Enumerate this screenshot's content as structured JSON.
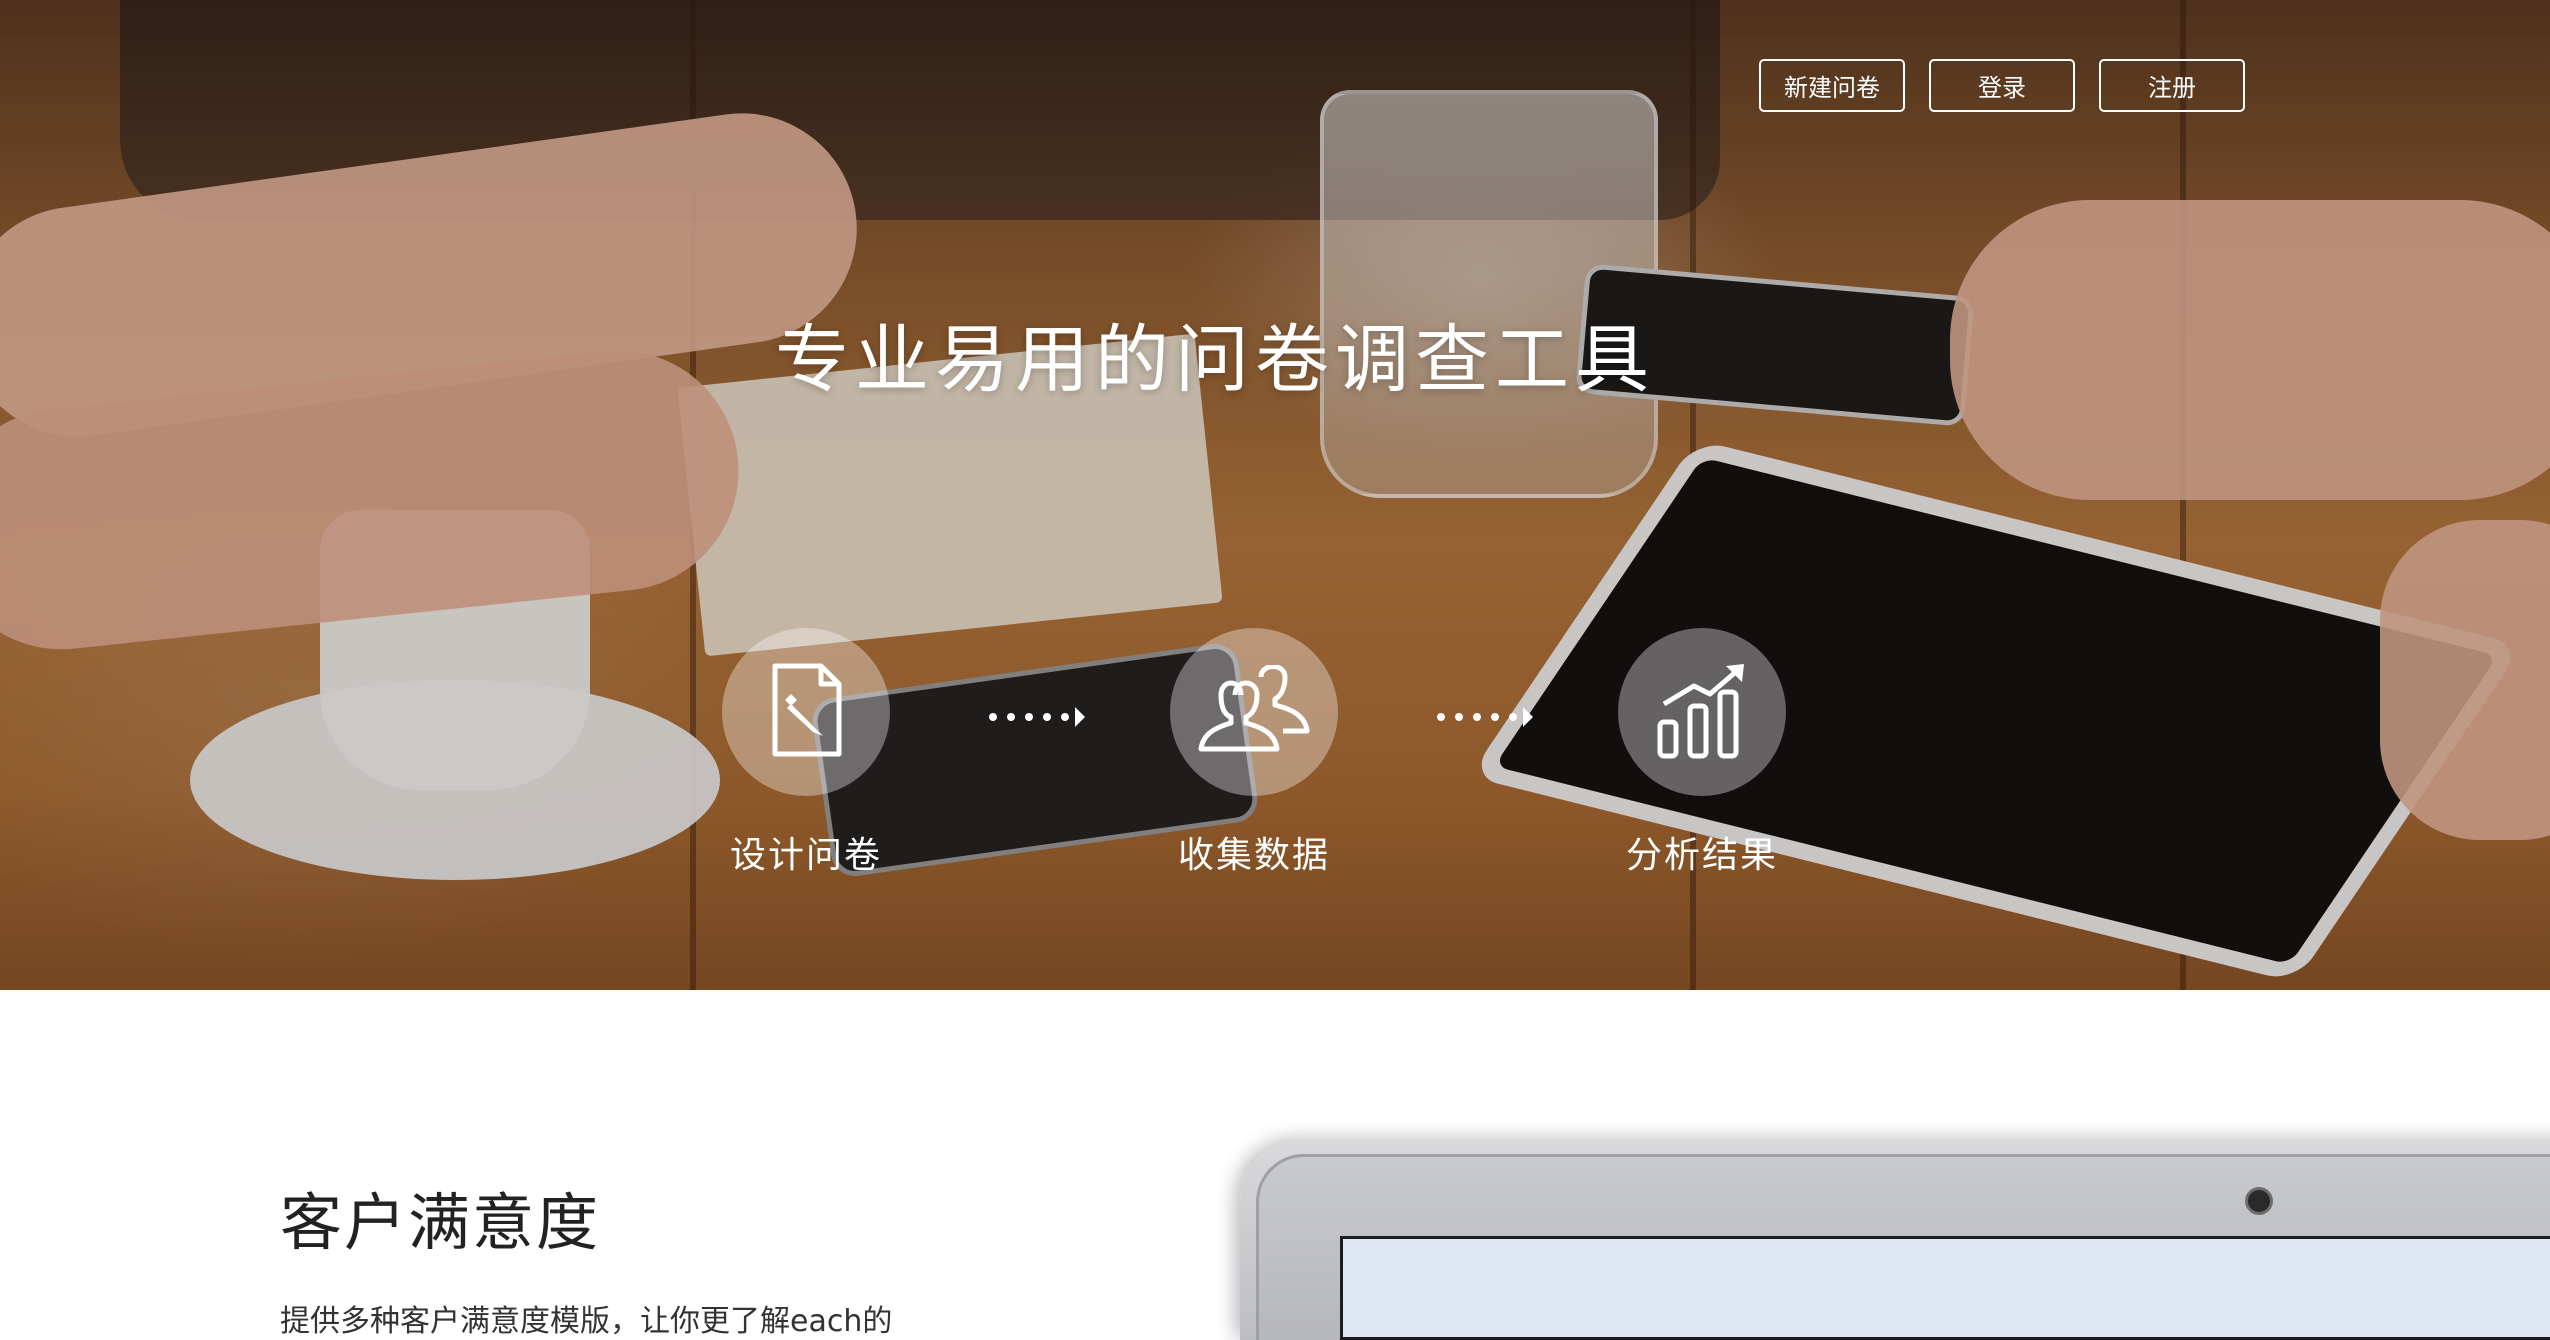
{
  "header": {
    "buttons": [
      {
        "label": "新建问卷"
      },
      {
        "label": "登录"
      },
      {
        "label": "注册"
      }
    ]
  },
  "hero": {
    "title": "专业易用的问卷调查工具",
    "steps": [
      {
        "label": "设计问卷",
        "icon": "document-pencil-icon"
      },
      {
        "label": "收集数据",
        "icon": "users-icon"
      },
      {
        "label": "分析结果",
        "icon": "bar-chart-trend-icon"
      }
    ],
    "arrow_icon": "dotted-arrow-icon"
  },
  "feature": {
    "title": "客户满意度",
    "description": "提供多种客户满意度模版，让你更了解each的"
  },
  "colors": {
    "hero_text": "#ffffff",
    "page_bg": "#ffffff",
    "section_title": "#222222"
  }
}
